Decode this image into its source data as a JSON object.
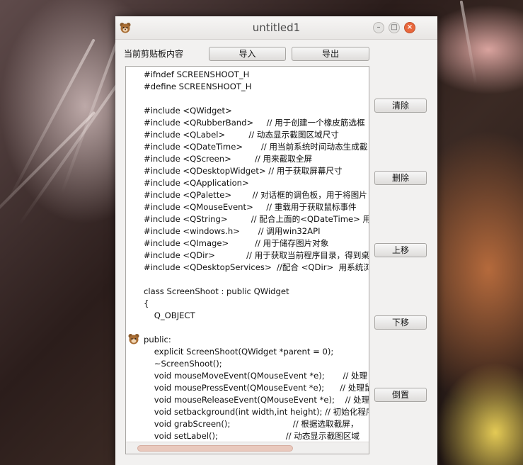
{
  "window": {
    "title": "untitled1",
    "buttons": {
      "minimize": "–",
      "maximize": "□",
      "close": "×"
    }
  },
  "toolbar": {
    "label": "当前剪贴板内容",
    "import_label": "导入",
    "export_label": "导出"
  },
  "side_buttons": {
    "clear": "清除",
    "delete": "删除",
    "move_up": "上移",
    "move_down": "下移",
    "reverse": "倒置"
  },
  "editor": {
    "lines": [
      "#ifndef SCREENSHOOT_H",
      "#define SCREENSHOOT_H",
      "",
      "#include <QWidget>",
      "#include <QRubberBand>     // 用于创建一个橡皮筋选框",
      "#include <QLabel>         // 动态显示截图区域尺寸",
      "#include <QDateTime>       // 用当前系统时间动态生成截",
      "#include <QScreen>         // 用来截取全屏",
      "#include <QDesktopWidget> // 用于获取屏幕尺寸",
      "#include <QApplication>",
      "#include <QPalette>        // 对话框的调色板，用于将图片",
      "#include <QMouseEvent>     // 重载用于获取鼠标事件",
      "#include <QString>         // 配合上面的<QDateTime> 用",
      "#include <windows.h>       // 调用win32API",
      "#include <QImage>          // 用于储存图片对象",
      "#include <QDir>            // 用于获取当前程序目录，得到桌",
      "#include <QDesktopServices>  //配合 <QDir>  用系统浏",
      "",
      "class ScreenShoot : public QWidget",
      "{",
      "    Q_OBJECT",
      "",
      "public:",
      "    explicit ScreenShoot(QWidget *parent = 0);",
      "    ~ScreenShoot();",
      "    void mouseMoveEvent(QMouseEvent *e);       // 处理",
      "    void mousePressEvent(QMouseEvent *e);      // 处理鼠",
      "    void mouseReleaseEvent(QMouseEvent *e);    // 处理鼠",
      "    void setbackground(int width,int height); // 初始化程序",
      "    void grabScreen();                        // 根据选取截屏，",
      "    void setLabel();                          // 动态显示截图区域"
    ]
  },
  "icons": {
    "app": "bear-face-icon",
    "cursor": "bear-cursor-icon"
  }
}
